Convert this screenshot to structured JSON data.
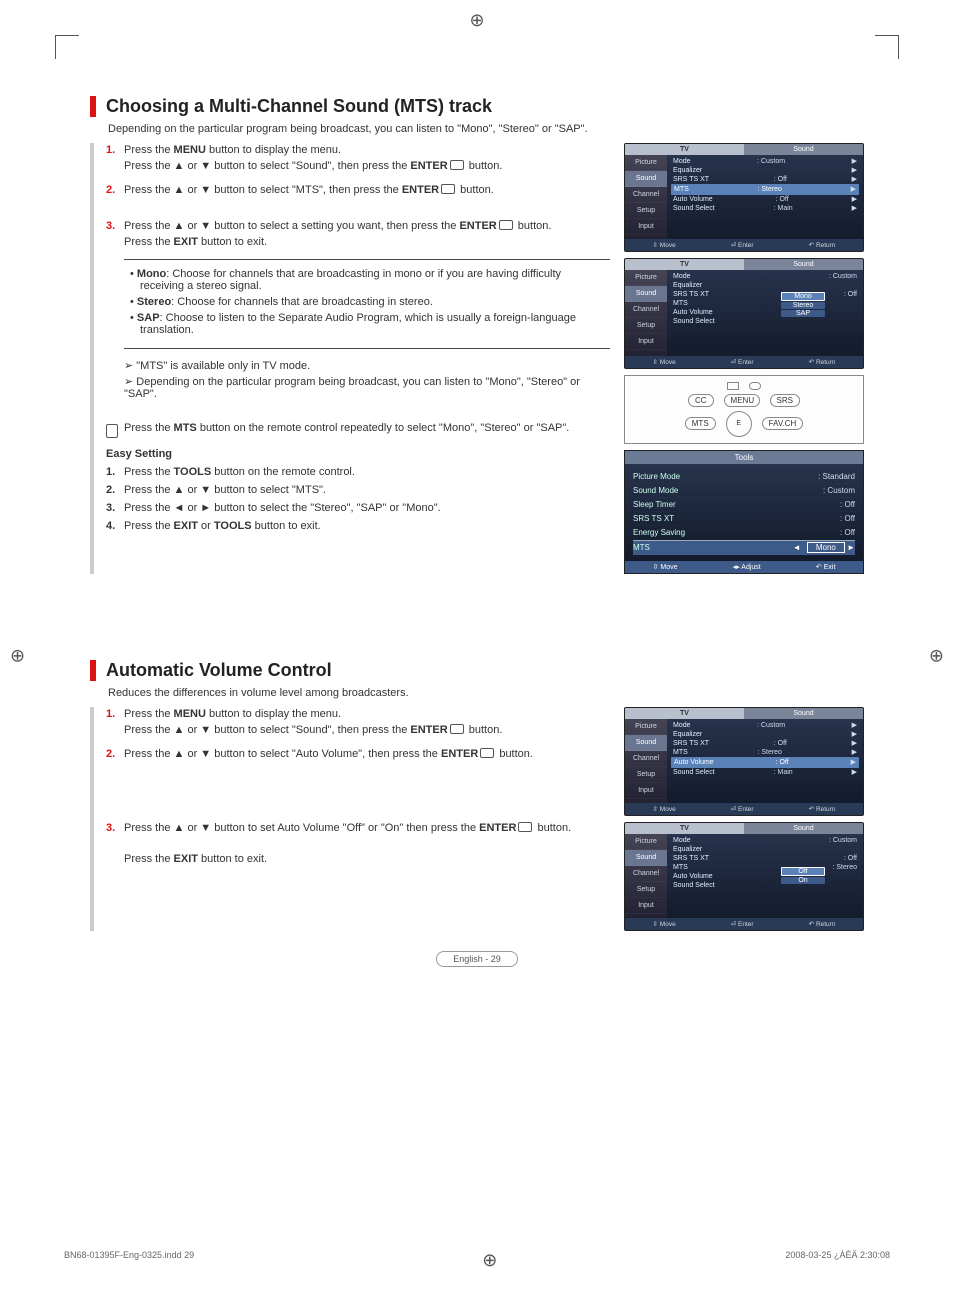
{
  "regmark": "⊕",
  "section1": {
    "title": "Choosing a Multi-Channel Sound (MTS) track",
    "intro": "Depending on the particular program being broadcast, you can listen to \"Mono\", \"Stereo\" or \"SAP\".",
    "steps": {
      "1a": "Press the ",
      "1b": "MENU",
      "1c": " button to display the menu.",
      "1d": "Press the ▲ or ▼ button to select \"Sound\", then press the ",
      "1e": "ENTER",
      "1f": " button.",
      "2a": "Press the ▲ or ▼ button to select \"MTS\", then press the ",
      "2b": "ENTER",
      "2c": " button.",
      "3a": "Press the ▲ or ▼ button to select a setting you want, then press the ",
      "3b": "ENTER",
      "3c": " button.",
      "3d": "Press the ",
      "3e": "EXIT",
      "3f": " button to exit."
    },
    "bullets": {
      "mono_b": "Mono",
      "mono": ": Choose for channels that are broadcasting in mono or if you are having difficulty receiving a stereo signal.",
      "stereo_b": "Stereo",
      "stereo": ": Choose for channels that are broadcasting in stereo.",
      "sap_b": "SAP",
      "sap": ": Choose to listen to the Separate Audio Program, which is usually a foreign-language translation."
    },
    "notes": {
      "n1": "➢ \"MTS\" is available only in TV mode.",
      "n2": "➢ Depending on the particular program being broadcast, you can listen to \"Mono\", \"Stereo\" or \"SAP\"."
    },
    "remote_tip_a": "Press the ",
    "remote_tip_b": "MTS",
    "remote_tip_c": " button on the remote control repeatedly to select \"Mono\", \"Stereo\" or \"SAP\".",
    "easy": {
      "title": "Easy Setting",
      "s1a": "Press the ",
      "s1b": "TOOLS",
      "s1c": " button on the remote control.",
      "s2": "Press the ▲ or ▼ button to select \"MTS\".",
      "s3": "Press the ◄ or ► button to select the \"Stereo\", \"SAP\" or  \"Mono\".",
      "s4a": "Press the ",
      "s4b": "EXIT",
      "s4c": " or ",
      "s4d": "TOOLS",
      "s4e": " button to exit."
    }
  },
  "osd_common": {
    "tv": "TV",
    "sound": "Sound",
    "side_picture": "Picture",
    "side_sound": "Sound",
    "side_channel": "Channel",
    "side_setup": "Setup",
    "side_input": "Input",
    "mode": "Mode",
    "equalizer": "Equalizer",
    "srs": "SRS TS XT",
    "mts": "MTS",
    "autovol": "Auto Volume",
    "soundsel": "Sound Select",
    "custom": ": Custom",
    "off": ": Off",
    "stereo": ": Stereo",
    "main": ": Main",
    "foot_move": "Move",
    "foot_enter": "Enter",
    "foot_return": "Return"
  },
  "osd2_opts": {
    "mono": "Mono",
    "stereo": "Stereo",
    "sap": "SAP"
  },
  "remote_btns": {
    "cc": "CC",
    "menu": "MENU",
    "srs": "SRS",
    "mts": "MTS",
    "e": "E",
    "fav": "FAV.CH"
  },
  "tools": {
    "hd": "Tools",
    "pm_k": "Picture Mode",
    "pm_v": ":  Standard",
    "sm_k": "Sound Mode",
    "sm_v": ":  Custom",
    "st_k": "Sleep Timer",
    "st_v": ":  Off",
    "sr_k": "SRS TS XT",
    "sr_v": ":  Off",
    "es_k": "Energy Saving",
    "es_v": ":  Off",
    "mts_k": "MTS",
    "mts_v": "Mono",
    "ft_move": "Move",
    "ft_adj": "Adjust",
    "ft_exit": "Exit"
  },
  "section2": {
    "title": "Automatic Volume Control",
    "intro": "Reduces the differences in volume level among broadcasters.",
    "s1a": "Press the ",
    "s1b": "MENU",
    "s1c": " button to display the menu.",
    "s1d": "Press the ▲ or ▼ button to select \"Sound\", then press the ",
    "s1e": "ENTER",
    "s1f": " button.",
    "s2a": "Press the ▲ or ▼ button to select \"Auto Volume\", then press the ",
    "s2b": "ENTER",
    "s2c": " button.",
    "s3a": "Press the ▲ or ▼ button to set Auto Volume \"Off\" or \"On\" then press the ",
    "s3b": "ENTER",
    "s3c": " button.",
    "s3d": "Press the ",
    "s3e": "EXIT",
    "s3f": " button to exit."
  },
  "osd_av_opts": {
    "off": "Off",
    "on": "On"
  },
  "page_footer": "English - 29",
  "print_left": "BN68-01395F-Eng-0325.indd   29",
  "print_right": "2008-03-25   ¿ÀÈÄ 2:30:08"
}
